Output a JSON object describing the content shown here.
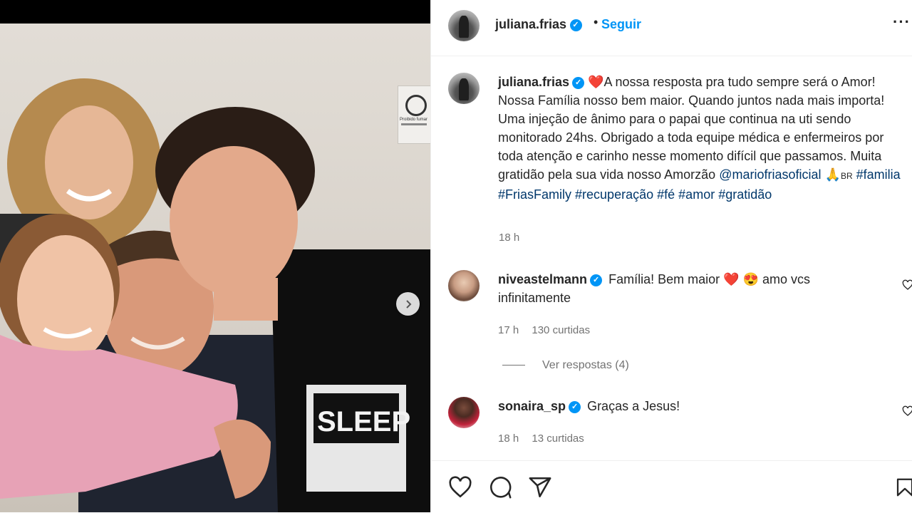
{
  "post": {
    "author": "juliana.frias",
    "follow_label": "Seguir",
    "more_label": "···",
    "caption_text": "A nossa resposta pra tudo sempre será o Amor! Nossa Família nosso bem maior. Quando juntos nada mais importa! Uma injeção de ânimo para o papai que continua na uti sendo monitorado 24hs. Obrigado a toda equipe médica e enfermeiros por toda atenção e carinho nesse momento difícil que passamos. Muita gratidão pela sua vida nosso Amorzão",
    "mention": "@mariofriasoficial",
    "flag_text": "BR",
    "hashtags": [
      "#familia",
      "#FriasFamily",
      "#recuperação",
      "#fé",
      "#amor",
      "#gratidão"
    ],
    "time": "18 h",
    "heart_emoji": "❤️",
    "pray_emoji": "🙏"
  },
  "comments": [
    {
      "username": "niveastelmann",
      "text_part1": "Família! Bem maior",
      "emojis": "❤️ 😍",
      "text_part2": "amo vcs infinitamente",
      "time": "17 h",
      "likes": "130 curtidas"
    },
    {
      "username": "sonaira_sp",
      "text": "Graças a Jesus!",
      "time": "18 h",
      "likes": "13 curtidas"
    }
  ],
  "replies_label": "Ver respostas (4)",
  "photo_sign_text": "Proibido fumar",
  "photo_shirt_text": "SLEEP",
  "colors": {
    "link_blue": "#0095f6",
    "tag_blue": "#00376b",
    "verified_blue": "#0095f6",
    "muted_gray": "#737373",
    "heart_red": "#e0163b"
  },
  "icons": [
    "verified-icon",
    "more-options-icon",
    "heart-icon",
    "comment-icon",
    "share-icon",
    "bookmark-icon",
    "chevron-right-icon"
  ]
}
